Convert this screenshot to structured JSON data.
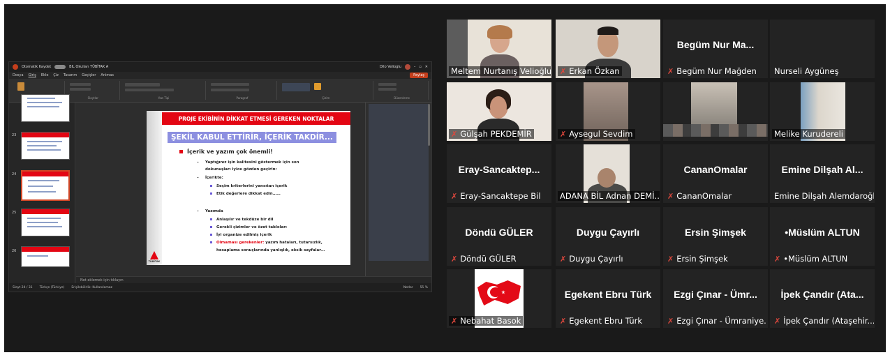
{
  "powerpoint": {
    "autosave": "Otomatik Kaydet",
    "filename": "BIL Okulları TÜBİTAK A",
    "user": "Dilo Velioglu",
    "menu": [
      "Dosya",
      "Giriş",
      "Ekle",
      "Çiz",
      "Tasarım",
      "Geçişler",
      "Animas"
    ],
    "share_label": "Paylaş",
    "ribbon_groups": [
      "Pano",
      "Slaytlar",
      "Yazı Tipi",
      "Paragraf",
      "Çizim",
      "Düzenleme"
    ],
    "notes_placeholder": "Not eklemek için tıklayın",
    "status_slide": "Slayt 24 / 31",
    "status_lang": "Türkçe (Türkiye)",
    "status_access": "Erişilebilirlik: Kullanılamaz",
    "status_notes": "Notlar",
    "zoom": "55 %",
    "thumb_numbers": [
      "23",
      "24",
      "25",
      "26"
    ]
  },
  "slide": {
    "header": "PROJE EKİBİNİN DİKKAT ETMESİ GEREKEN NOKTALAR",
    "subtitle": "ŞEKİL KABUL ETTİRİR, İÇERİK TAKDİR...",
    "heading": "İçerik ve yazım çok önemli!",
    "lines": {
      "l1": "Yaptığınız işin kalitesini göstermek için son",
      "l2": "dokunuşları iyice gözden geçirin:",
      "l3": "İçerikte:",
      "l4": "Seçim kriterlerini yansıtan içerik",
      "l5": "Etik değerlere dikkat edin……",
      "l6": "Yazımda",
      "l7": "Anlaşılır ve tekdüze bir dil",
      "l8": "Gerekli çizimler ve özet tabloları",
      "l9": "İyi organize edilmiş içerik",
      "l10a": "Olmaması gerekenler:",
      "l10b": " yazım hataları, tutarsızlık,",
      "l11": "hesaplama sonuçlarında yanlışlık, eksik sayfalar…"
    },
    "logo_text": "TÜBİTAK"
  },
  "participants": [
    {
      "caption": "Meltem Nurtanış Velioğlu",
      "muted": false,
      "video": true
    },
    {
      "caption": "Erkan Özkan",
      "muted": true,
      "video": true
    },
    {
      "big": "Begüm Nur Ma...",
      "caption": "Begüm Nur Mağden",
      "muted": true,
      "video": false
    },
    {
      "caption": "Nurseli Aygüneş",
      "muted": false,
      "video": false
    },
    {
      "caption": "Gülşah PEKDEMİR",
      "muted": true,
      "video": true
    },
    {
      "caption": "Aysegul Sevdim",
      "muted": true,
      "video": true
    },
    {
      "caption": "",
      "muted": false,
      "video": true
    },
    {
      "caption": "Melike Kurudereli",
      "muted": false,
      "video": true
    },
    {
      "big": "Eray-Sancaktep...",
      "caption": "Eray-Sancaktepe Bil",
      "muted": true,
      "video": false
    },
    {
      "caption": "ADANA BİL Adnan DEMİ...",
      "muted": false,
      "video": true
    },
    {
      "big": "CananOmalar",
      "caption": "CananOmalar",
      "muted": true,
      "video": false
    },
    {
      "big": "Emine Dilşah Al...",
      "caption": "Emine Dilşah Alemdaroğlu",
      "muted": false,
      "video": false
    },
    {
      "big": "Döndü GÜLER",
      "caption": "Döndü GÜLER",
      "muted": true,
      "video": false
    },
    {
      "big": "Duygu Çayırlı",
      "caption": "Duygu Çayırlı",
      "muted": true,
      "video": false
    },
    {
      "big": "Ersin Şimşek",
      "caption": "Ersin Şimşek",
      "muted": true,
      "video": false
    },
    {
      "big": "•Müslüm ALTUN",
      "caption": "•Müslüm ALTUN",
      "muted": true,
      "video": false
    },
    {
      "caption": "Nebahat Basok",
      "muted": true,
      "video": true
    },
    {
      "big": "Egekent Ebru Türk",
      "caption": "Egekent Ebru Türk",
      "muted": true,
      "video": false
    },
    {
      "big": "Ezgi Çınar - Ümr...",
      "caption": "Ezgi Çınar - Ümraniye...",
      "muted": true,
      "video": false
    },
    {
      "big": "İpek Çandır (Ata...",
      "caption": "İpek Çandır (Ataşehir...",
      "muted": true,
      "video": false
    }
  ],
  "colors": {
    "active_speaker": "#c9d94a",
    "muted_icon": "#e0483d",
    "slide_red": "#e30613",
    "subtitle_purple": "#8c8fe0"
  }
}
